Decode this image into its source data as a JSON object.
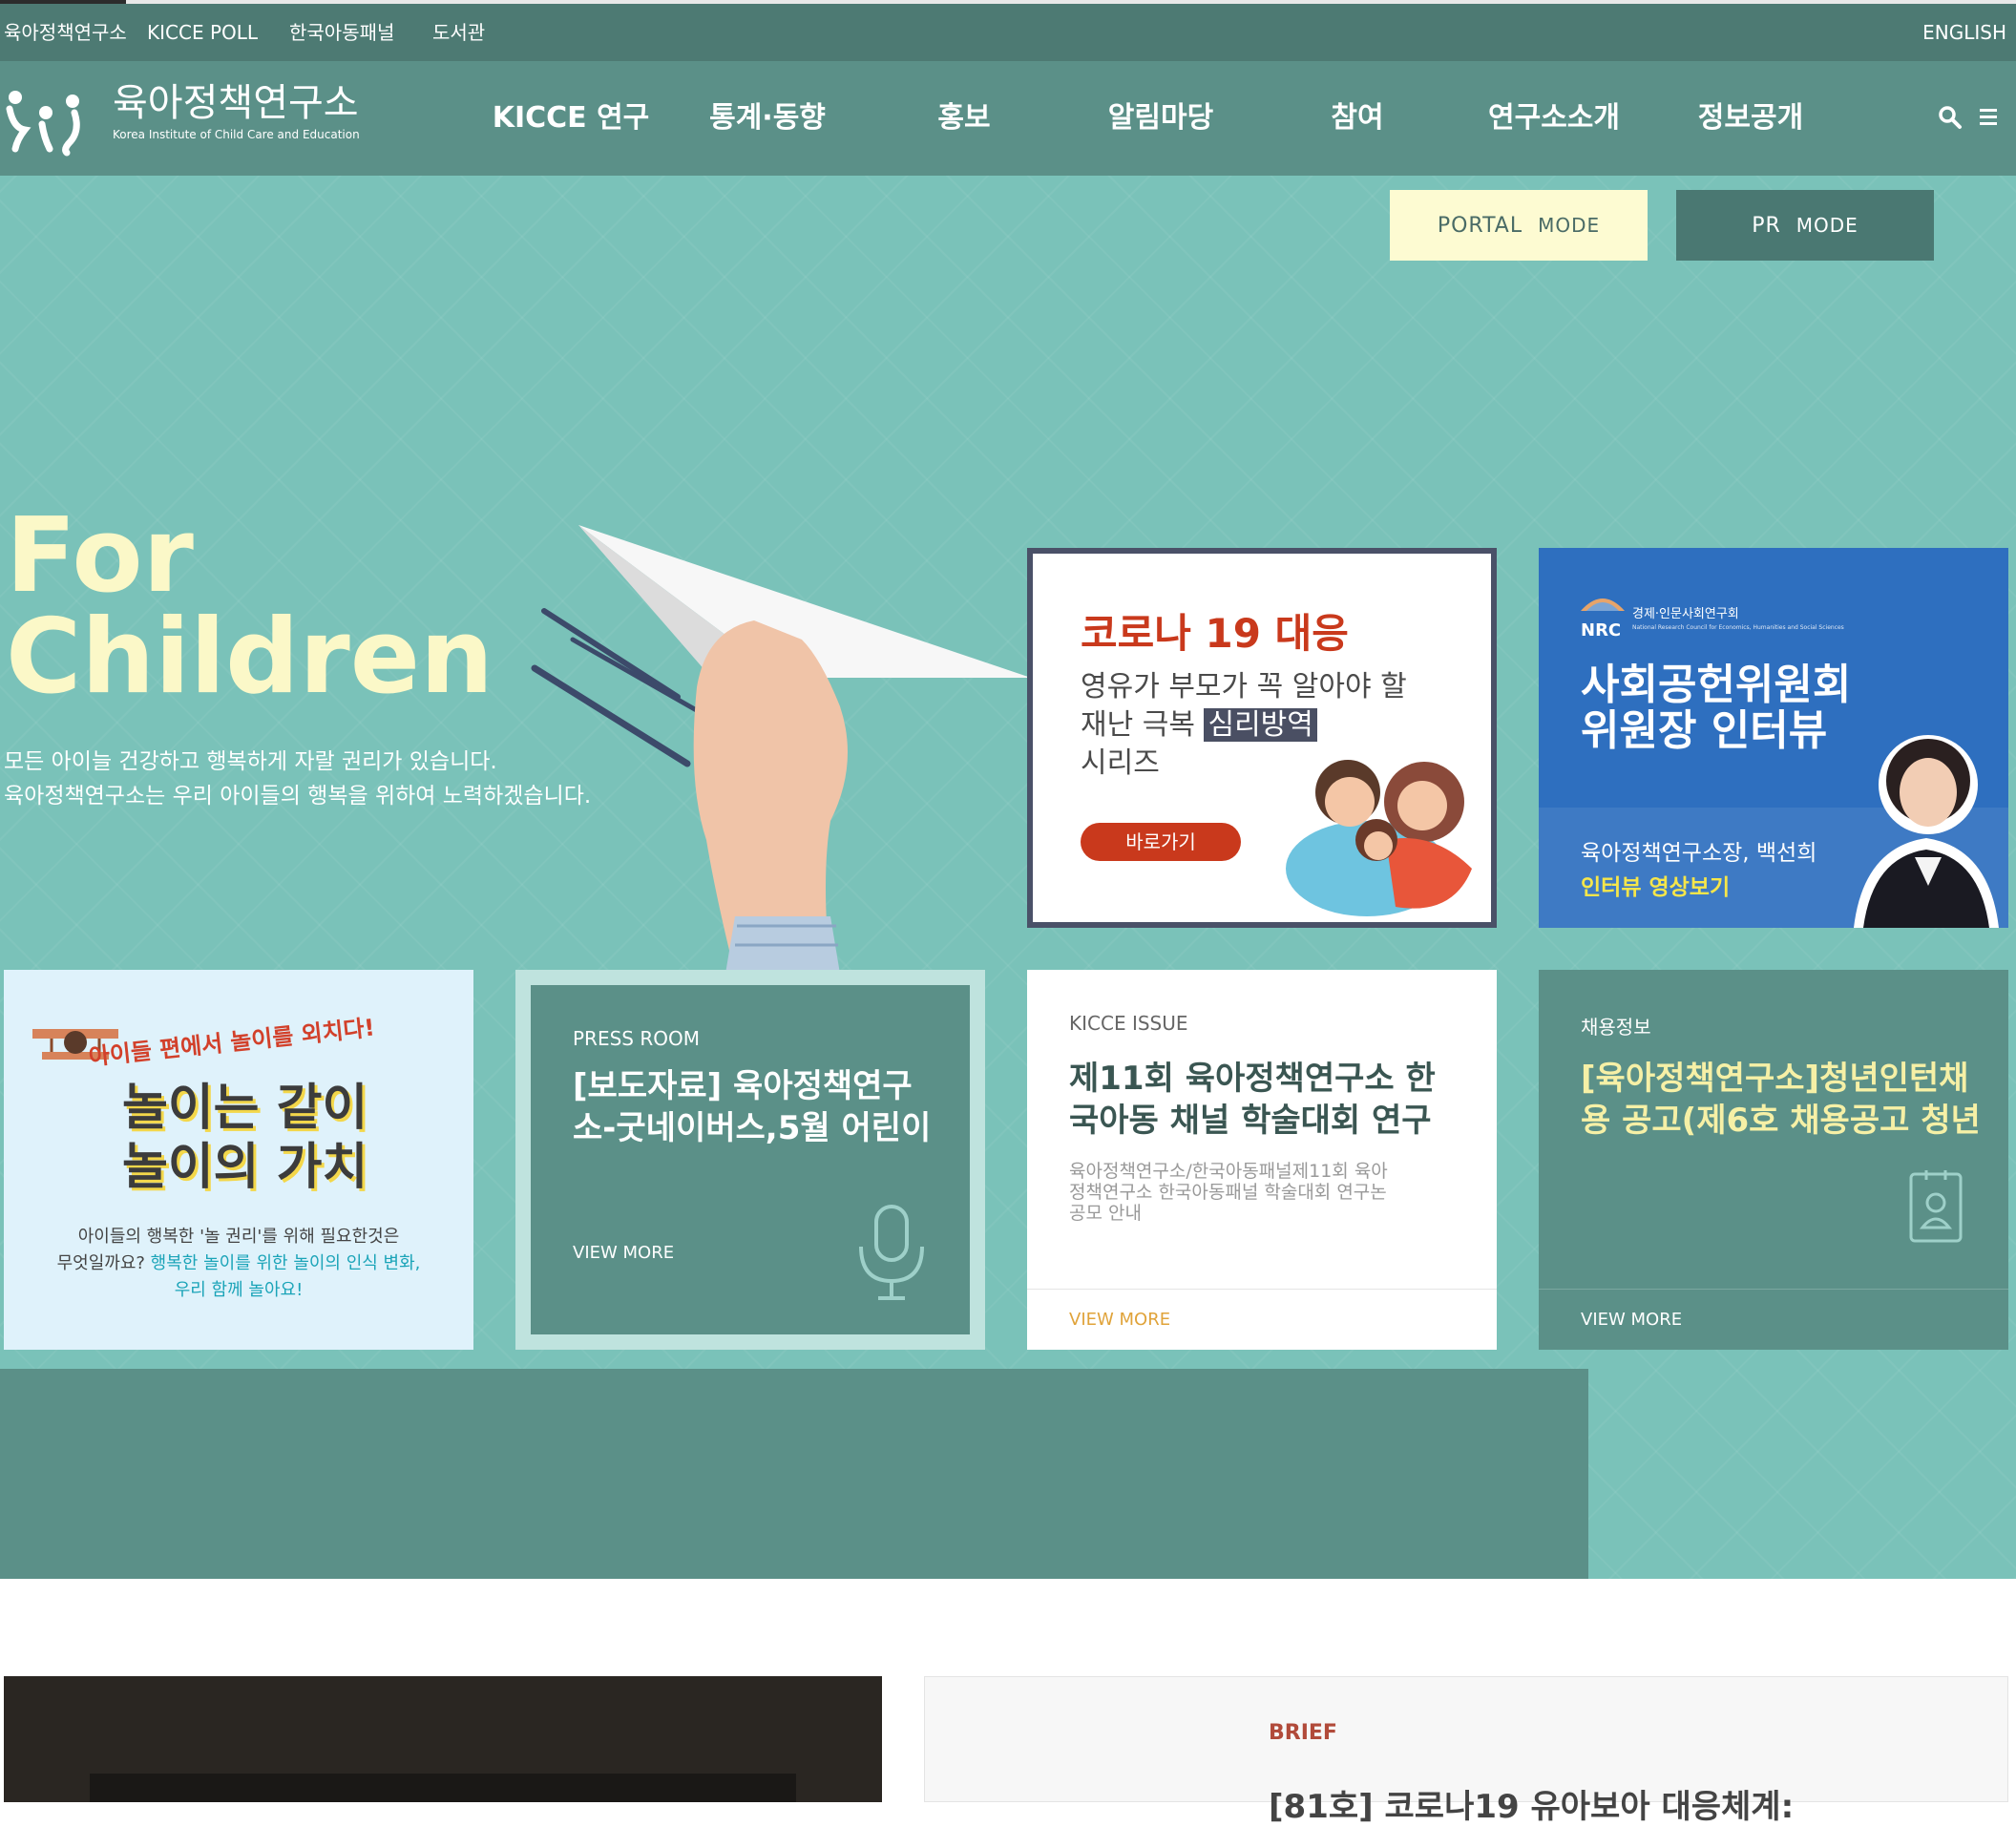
{
  "util": {
    "left_links": [
      "육아정책연구소",
      "KICCE POLL",
      "한국아동패널",
      "도서관"
    ],
    "english": "ENGLISH"
  },
  "logo": {
    "name_ko": "육아정책연구소",
    "name_en": "Korea Institute of Child Care and Education"
  },
  "nav": {
    "items": [
      "KICCE 연구",
      "통계·동향",
      "홍보",
      "알림마당",
      "참여",
      "연구소소개",
      "정보공개"
    ]
  },
  "modes": {
    "portal": [
      "PORTAL",
      "MODE"
    ],
    "pr": [
      "PR",
      "MODE"
    ]
  },
  "hero": {
    "title_line1": "For",
    "title_line2": "Children",
    "desc_line1": "모든 아이늘 건강하고 행복하게 자랄 권리가 있습니다.",
    "desc_line2": "육아정책연구소는 우리 아이들의 행복을 위하여 노력하겠습니다."
  },
  "covid_card": {
    "title": "코로나 19 대응",
    "line1": "영유가 부모가 꼭 알아야 할",
    "line2_pre": "재난 극복 ",
    "line2_hl": "심리방역",
    "line3": "시리즈",
    "button": "바로가기"
  },
  "nrc_card": {
    "org_ko": "경제·인문사회연구회",
    "org_short": "NRC",
    "org_en": "National Research Council for Economics, Humanities and Social Sciences",
    "title_line1": "사회공헌위원회",
    "title_line2": "위원장 인터뷰",
    "person": "육아정책연구소장, 백선희",
    "video": "인터뷰 영상보기"
  },
  "play_card": {
    "banner": "아이들 편에서 놀이를 외치다!",
    "title_line1": "놀이는 같이",
    "title_line2": "놀이의 가치",
    "desc_line1": "아이들의 행복한 '놀 권리'를 위해 필요한것은",
    "desc_line2_pre": "무엇일까요? ",
    "desc_line2_hl": "행복한 놀이를 위한 놀이의 인식 변화,",
    "desc_line3": "우리 함께 놀아요!"
  },
  "press_card": {
    "label": "PRESS ROOM",
    "title_line1": "[보도자료] 육아정책연구",
    "title_line2": "소-굿네이버스,5월 어린이",
    "more": "VIEW MORE"
  },
  "issue_card": {
    "label": "KICCE ISSUE",
    "title_line1": "제11회 육아정책연구소 한",
    "title_line2": "국아동 채널 학술대회 연구",
    "body_line1": "육아정책연구소/한국아동패널제11회 육아",
    "body_line2": "정책연구소 한국아동패널 학술대회 연구논",
    "body_line3": "공모 안내",
    "more": "VIEW MORE"
  },
  "job_card": {
    "label": "채용정보",
    "title_line1": "[육아정책연구소]청년인턴채",
    "title_line2": "용 공고(제6호 채용공고 청년",
    "more": "VIEW MORE"
  },
  "brief": {
    "label": "BRIEF",
    "title": "[81호] 코로나19 유아보아 대응체계:"
  },
  "colors": {
    "nav_bg": "#5b9088",
    "hero_bg": "#7ac2b9",
    "accent_yellow": "#fbf8c8",
    "covid_red": "#c9391c",
    "nrc_blue": "#2e6fbf"
  }
}
